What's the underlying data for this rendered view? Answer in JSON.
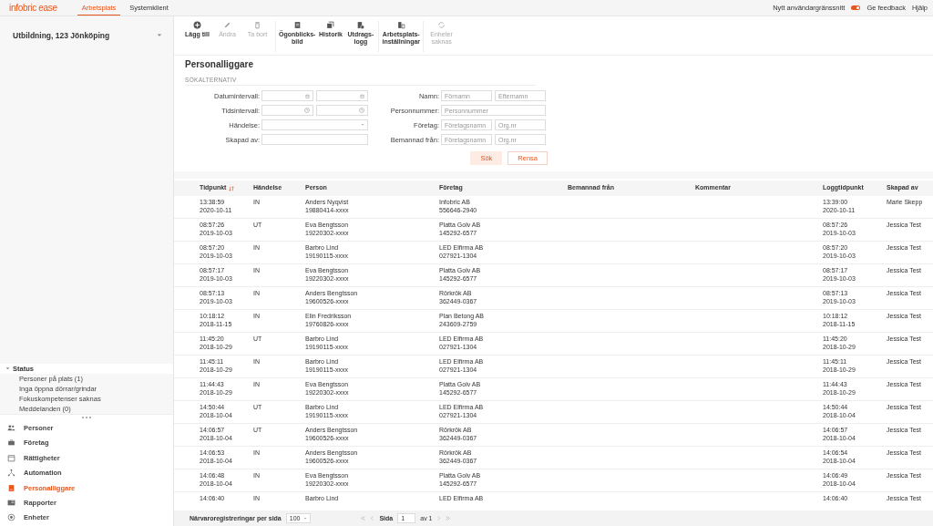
{
  "topbar": {
    "logo": "infobric ease",
    "tabs": [
      {
        "label": "Arbetsplats",
        "selected": true
      },
      {
        "label": "Systemklient",
        "selected": false
      }
    ],
    "new_ui": {
      "label": "Nytt användargränssnitt",
      "on": true
    },
    "links": [
      "Ge feedback",
      "Hjälp"
    ]
  },
  "sidebar": {
    "workplace": "Utbildning, 123 Jönköping",
    "status": {
      "title": "Status",
      "expanded": true,
      "items": [
        "Personer på plats (1)",
        "Inga öppna dörrar/grindar",
        "Fokuskompetenser saknas",
        "Meddelanden (0)"
      ]
    },
    "nav": [
      {
        "label": "Personer",
        "selected": false
      },
      {
        "label": "Företag",
        "selected": false
      },
      {
        "label": "Rättigheter",
        "selected": false
      },
      {
        "label": "Automation",
        "selected": false
      },
      {
        "label": "Personalliggare",
        "selected": true
      },
      {
        "label": "Rapporter",
        "selected": false
      },
      {
        "label": "Enheter",
        "selected": false
      }
    ]
  },
  "toolbar": [
    [
      {
        "label": "Lägg till",
        "disabled": false
      },
      {
        "label": "Ändra",
        "disabled": true
      },
      {
        "label": "Ta bort",
        "disabled": true
      }
    ],
    [
      {
        "label": "Ögonblicks-\nbild",
        "disabled": false
      },
      {
        "label": "Historik",
        "disabled": false
      },
      {
        "label": "Utdrags-\nlogg",
        "disabled": false
      }
    ],
    [
      {
        "label": "Arbetsplats-\ninställningar",
        "disabled": false
      }
    ],
    [
      {
        "label": "Enheter\nsaknas",
        "disabled": true
      }
    ]
  ],
  "page_title": "Personalliggare",
  "search": {
    "section": "SÖKALTERNATIV",
    "left": [
      {
        "label": "Datumintervall:",
        "fields": [
          {
            "kind": "date"
          },
          {
            "kind": "date"
          }
        ]
      },
      {
        "label": "Tidsintervall:",
        "fields": [
          {
            "kind": "time"
          },
          {
            "kind": "time"
          }
        ]
      },
      {
        "label": "Händelse:",
        "fields": [
          {
            "kind": "select"
          }
        ]
      },
      {
        "label": "Skapad av:",
        "fields": [
          {
            "kind": "text"
          }
        ]
      }
    ],
    "right": [
      {
        "label": "Namn:",
        "fields": [
          {
            "kind": "text",
            "placeholder": "Förnamn"
          },
          {
            "kind": "text",
            "placeholder": "Efternamn"
          }
        ]
      },
      {
        "label": "Personnummer:",
        "fields": [
          {
            "kind": "text",
            "placeholder": "Personnummer"
          }
        ]
      },
      {
        "label": "Företag:",
        "fields": [
          {
            "kind": "text",
            "placeholder": "Företagsnamn"
          },
          {
            "kind": "text",
            "placeholder": "Org.nr"
          }
        ]
      },
      {
        "label": "Bemannad från:",
        "fields": [
          {
            "kind": "text",
            "placeholder": "Företagsnamn"
          },
          {
            "kind": "text",
            "placeholder": "Org.nr"
          }
        ]
      }
    ],
    "buttons": [
      "Sök",
      "Rensa"
    ]
  },
  "table": {
    "columns": [
      {
        "label": "Tidpunkt",
        "sorted": true
      },
      {
        "label": "Händelse",
        "sorted": false
      },
      {
        "label": "Person",
        "sorted": false
      },
      {
        "label": "Företag",
        "sorted": false
      },
      {
        "label": "Bemannad från",
        "sorted": false
      },
      {
        "label": "Kommentar",
        "sorted": false
      },
      {
        "label": "Loggtidpunkt",
        "sorted": false
      },
      {
        "label": "Skapad av",
        "sorted": false
      }
    ],
    "rows": [
      [
        "13:38:59\n2020-10-11",
        "IN",
        "Anders Nyqvist\n19880414-xxxx",
        "Infobric AB\n556646-2940",
        "",
        "",
        "13:39:00\n2020-10-11",
        "Marie Skepp"
      ],
      [
        "08:57:26\n2019-10-03",
        "UT",
        "Eva Bengtsson\n19220302-xxxx",
        "Platta Golv AB\n145292-6577",
        "",
        "",
        "08:57:26\n2019-10-03",
        "Jessica Test"
      ],
      [
        "08:57:20\n2019-10-03",
        "IN",
        "Barbro Lind\n19190115-xxxx",
        "LED Elfirma AB\n027921-1304",
        "",
        "",
        "08:57:20\n2019-10-03",
        "Jessica Test"
      ],
      [
        "08:57:17\n2019-10-03",
        "IN",
        "Eva Bengtsson\n19220302-xxxx",
        "Platta Golv AB\n145292-6577",
        "",
        "",
        "08:57:17\n2019-10-03",
        "Jessica Test"
      ],
      [
        "08:57:13\n2019-10-03",
        "IN",
        "Anders Bengtsson\n19600526-xxxx",
        "Rörkrök AB\n362449-0367",
        "",
        "",
        "08:57:13\n2019-10-03",
        "Jessica Test"
      ],
      [
        "10:18:12\n2018-11-15",
        "IN",
        "Elin Fredriksson\n19760826-xxxx",
        "Plan Betong AB\n243609-2759",
        "",
        "",
        "10:18:12\n2018-11-15",
        "Jessica Test"
      ],
      [
        "11:45:20\n2018-10-29",
        "UT",
        "Barbro Lind\n19190115-xxxx",
        "LED Elfirma AB\n027921-1304",
        "",
        "",
        "11:45:20\n2018-10-29",
        "Jessica Test"
      ],
      [
        "11:45:11\n2018-10-29",
        "IN",
        "Barbro Lind\n19190115-xxxx",
        "LED Elfirma AB\n027921-1304",
        "",
        "",
        "11:45:11\n2018-10-29",
        "Jessica Test"
      ],
      [
        "11:44:43\n2018-10-29",
        "IN",
        "Eva Bengtsson\n19220302-xxxx",
        "Platta Golv AB\n145292-6577",
        "",
        "",
        "11:44:43\n2018-10-29",
        "Jessica Test"
      ],
      [
        "14:50:44\n2018-10-04",
        "UT",
        "Barbro Lind\n19190115-xxxx",
        "LED Elfirma AB\n027921-1304",
        "",
        "",
        "14:50:44\n2018-10-04",
        "Jessica Test"
      ],
      [
        "14:06:57\n2018-10-04",
        "UT",
        "Anders Bengtsson\n19600526-xxxx",
        "Rörkrök AB\n362449-0367",
        "",
        "",
        "14:06:57\n2018-10-04",
        "Jessica Test"
      ],
      [
        "14:06:53\n2018-10-04",
        "IN",
        "Anders Bengtsson\n19600526-xxxx",
        "Rörkrök AB\n362449-0367",
        "",
        "",
        "14:06:54\n2018-10-04",
        "Jessica Test"
      ],
      [
        "14:06:48\n2018-10-04",
        "IN",
        "Eva Bengtsson\n19220302-xxxx",
        "Platta Golv AB\n145292-6577",
        "",
        "",
        "14:06:49\n2018-10-04",
        "Jessica Test"
      ],
      [
        "14:06:40",
        "IN",
        "Barbro Lind",
        "LED Elfirma AB",
        "",
        "",
        "14:06:40",
        "Jessica Test"
      ]
    ]
  },
  "pager": {
    "per_page_label": "Närvaroregistreringar per sida",
    "per_page": "100",
    "page_label": "Sida",
    "page": "1",
    "of": "av 1"
  }
}
